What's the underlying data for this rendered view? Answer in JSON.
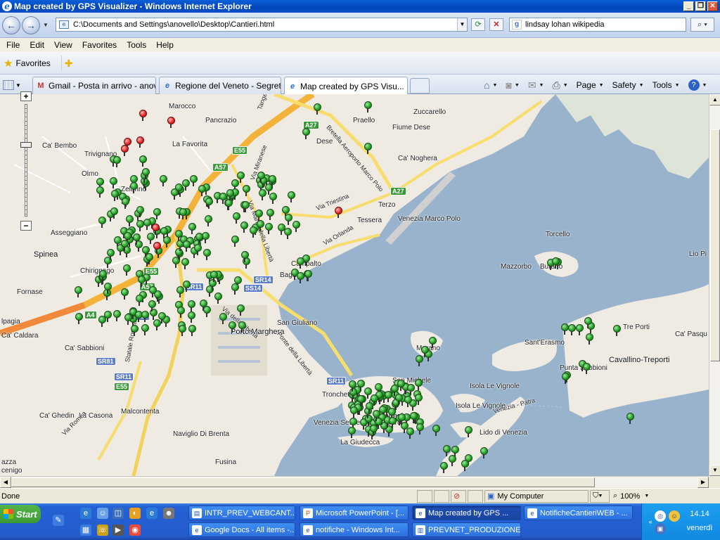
{
  "window": {
    "title": "Map created by GPS Visualizer - Windows Internet Explorer",
    "minimize": "_",
    "maximize": "❐",
    "close": "✕"
  },
  "address": {
    "url": "C:\\Documents and Settings\\anovello\\Desktop\\Cantieri.html",
    "search_value": "lindsay lohan wikipedia"
  },
  "menu": [
    "File",
    "Edit",
    "View",
    "Favorites",
    "Tools",
    "Help"
  ],
  "favorites": {
    "label": "Favorites"
  },
  "tabs": [
    {
      "label": "Gmail - Posta in arrivo - anov...",
      "icon": "gmail-icon"
    },
    {
      "label": "Regione del Veneto - Segret...",
      "icon": "ie-icon"
    },
    {
      "label": "Map created by GPS Visu...",
      "icon": "ie-icon",
      "active": true
    }
  ],
  "command_bar": {
    "page": "Page",
    "safety": "Safety",
    "tools": "Tools"
  },
  "map": {
    "labels": [
      "Marocco",
      "Pancrazio",
      "Praello",
      "Zuccarello",
      "Fiume Dese",
      "Ca' Bembo",
      "La Favorita",
      "Dese",
      "Trivignano",
      "Ca' Noghera",
      "Olmo",
      "Zelarino",
      "Terzo",
      "Venezia Marco Polo",
      "Asseggiano",
      "Tessera",
      "Spinea",
      "Torcello",
      "Mazzorbo",
      "Burano",
      "Chirignago",
      "Campalto",
      "Lio Pi",
      "Fornase",
      "Bagaro",
      "San Giuliano",
      "Tre Porti",
      "Ca' Pasqu",
      "lpagia",
      "Ca' Caldara",
      "Murano",
      "Sant'Erasmo",
      "Ca' Sabbioni",
      "Porto Marghera",
      "San Michele",
      "Cavallino-Treporti",
      "Punta Sabbioni",
      "Tronchetto",
      "Isola Le Vignole",
      "Venezia Sestiere Dorsoduro",
      "Venezia",
      "Isola Le Vignole",
      "Ca' Ghedin",
      "La Casona",
      "Malcontenta",
      "Lido di Venezia",
      "La Giudecca",
      "Naviglio Di Brenta",
      "Fusina",
      "azza",
      "cenigo",
      "Via Triestina",
      "Via Orlanda",
      "Ponte della Libertà",
      "Via della Libertà",
      "Bretella Aeroporto Marco Polo",
      "Statale Romea",
      "Via Romea",
      "Venezia - Patra",
      "Tangenziale di Mestre",
      "Via Miranese",
      "Via Martiri della Libertà"
    ],
    "shields": [
      "A27",
      "A27",
      "E55",
      "A57",
      "E55",
      "A57",
      "A4",
      "SS309",
      "SR11",
      "SR14",
      "SS14",
      "SR11",
      "SR11",
      "E55",
      "SR81"
    ],
    "markers_green_count": 300,
    "markers_red_count": 8
  },
  "status": {
    "text": "Done",
    "zone": "My Computer",
    "zoom": "100%"
  },
  "taskbar": {
    "start": "Start",
    "buttons": [
      "INTR_PREV_WEBCANT....",
      "Microsoft PowerPoint - [...",
      "Map created by GPS ...",
      "NotificheCantieriWEB - ...",
      "Google Docs - All items -...",
      "notifiche - Windows Int...",
      "PREVNET_PRODUZIONE...."
    ],
    "clock": "14.14",
    "day": "venerdì"
  },
  "colors": {
    "sea": "#99b3cc",
    "land": "#efebe2",
    "highway": "#f3b23a",
    "marker_green": "#1d9b1d",
    "marker_red": "#e01f1f"
  }
}
